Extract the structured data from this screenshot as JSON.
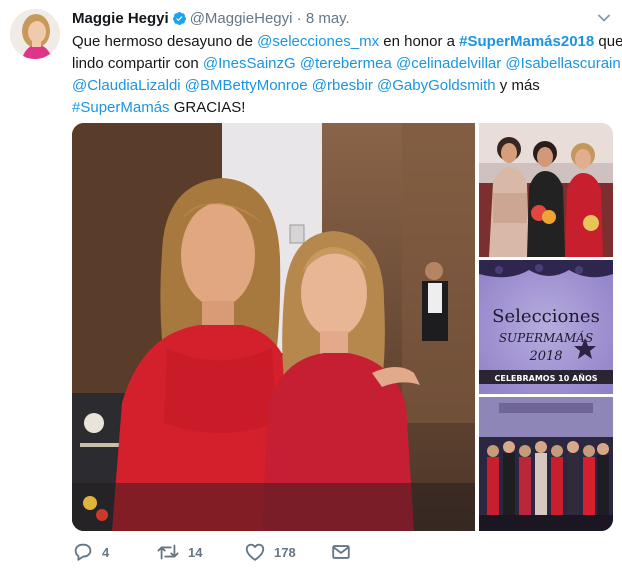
{
  "tweet": {
    "author_name": "Maggie Hegyi",
    "handle": "@MaggieHegyi",
    "separator": "·",
    "date": "8 may.",
    "text": {
      "line1": {
        "t1": "Que hermoso desayuno de ",
        "m1": "@selecciones_mx",
        "t2": " en honor a ",
        "h1": "#SuperMamás2018",
        "t3": " que"
      },
      "line2": {
        "t1": "lindo compartir con ",
        "m1": "@InesSainzG",
        "m2": "@terebermea",
        "m3": "@celinadelvillar",
        "m4": "@Isabellascurain"
      },
      "line3": {
        "m1": "@ClaudiaLizaldi",
        "m2": "@BMBettyMonroe",
        "m3": "@rbesbir",
        "m4": "@GabyGoldsmith",
        "t1": " y más"
      },
      "line4": {
        "h1": "#SuperMamás",
        "t1": " GRACIAS!"
      }
    },
    "banner": {
      "title": "Selecciones",
      "subtitle": "SUPERMAMÁS",
      "year": "2018",
      "ribbon": "CELEBRAMOS 10 AÑOS"
    },
    "actions": {
      "reply_count": "4",
      "retweet_count": "14",
      "like_count": "178"
    }
  },
  "colors": {
    "link": "#1b95e0",
    "muted": "#657786",
    "verified": "#1da1f2",
    "dress_red": "#d3202c",
    "banner_purple": "#8f7fc8"
  },
  "icons": {
    "reply": "reply-icon",
    "retweet": "retweet-icon",
    "like": "heart-icon",
    "dm": "envelope-icon",
    "verified": "verified-badge-icon",
    "menu": "chevron-down-icon"
  }
}
